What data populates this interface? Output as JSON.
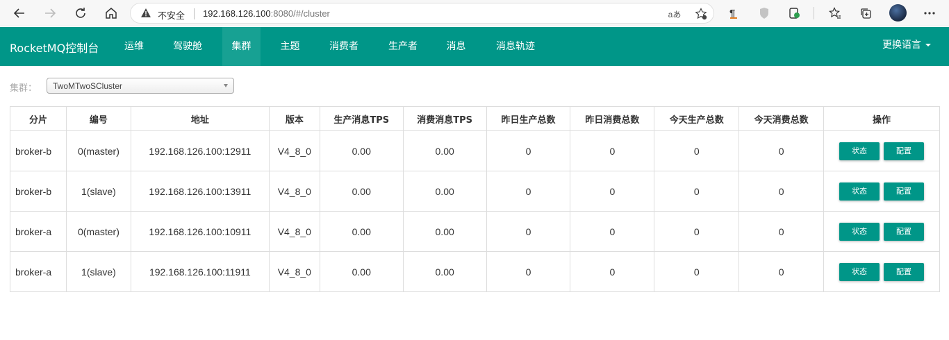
{
  "browser": {
    "insecure_label": "不安全",
    "url_host": "192.168.126.100",
    "url_rest": ":8080/#/cluster",
    "read_aloud": "aあ"
  },
  "nav": {
    "brand": "RocketMQ控制台",
    "items": [
      {
        "label": "运维",
        "active": false
      },
      {
        "label": "驾驶舱",
        "active": false
      },
      {
        "label": "集群",
        "active": true
      },
      {
        "label": "主题",
        "active": false
      },
      {
        "label": "消费者",
        "active": false
      },
      {
        "label": "生产者",
        "active": false
      },
      {
        "label": "消息",
        "active": false
      },
      {
        "label": "消息轨迹",
        "active": false
      }
    ],
    "language": "更换语言"
  },
  "cluster_select": {
    "label": "集群：",
    "value": "TwoMTwoSCluster"
  },
  "table": {
    "headers": [
      "分片",
      "编号",
      "地址",
      "版本",
      "生产消息TPS",
      "消费消息TPS",
      "昨日生产总数",
      "昨日消费总数",
      "今天生产总数",
      "今天消费总数",
      "操作"
    ],
    "rows": [
      [
        "broker-b",
        "0(master)",
        "192.168.126.100:12911",
        "V4_8_0",
        "0.00",
        "0.00",
        "0",
        "0",
        "0",
        "0"
      ],
      [
        "broker-b",
        "1(slave)",
        "192.168.126.100:13911",
        "V4_8_0",
        "0.00",
        "0.00",
        "0",
        "0",
        "0",
        "0"
      ],
      [
        "broker-a",
        "0(master)",
        "192.168.126.100:10911",
        "V4_8_0",
        "0.00",
        "0.00",
        "0",
        "0",
        "0",
        "0"
      ],
      [
        "broker-a",
        "1(slave)",
        "192.168.126.100:11911",
        "V4_8_0",
        "0.00",
        "0.00",
        "0",
        "0",
        "0",
        "0"
      ]
    ],
    "status_button": "状态",
    "config_button": "配置"
  },
  "colors": {
    "primary": "#009688",
    "active_nav": "#17a193"
  }
}
